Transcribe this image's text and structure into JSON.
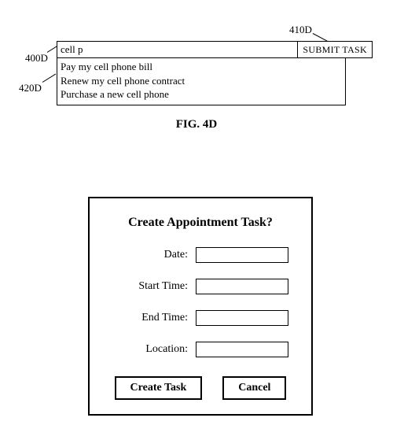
{
  "callouts": {
    "c400d": "400D",
    "c410d": "410D",
    "c420d": "420D"
  },
  "search": {
    "value": "cell p",
    "submit_label": "SUBMIT TASK",
    "suggestions": [
      "Pay my cell phone bill",
      "Renew my cell phone contract",
      "Purchase a new cell phone"
    ]
  },
  "figure_caption": "FIG. 4D",
  "dialog": {
    "title": "Create Appointment Task?",
    "fields": {
      "date": {
        "label": "Date:",
        "value": ""
      },
      "start_time": {
        "label": "Start Time:",
        "value": ""
      },
      "end_time": {
        "label": "End Time:",
        "value": ""
      },
      "location": {
        "label": "Location:",
        "value": ""
      }
    },
    "buttons": {
      "create": "Create Task",
      "cancel": "Cancel"
    }
  }
}
